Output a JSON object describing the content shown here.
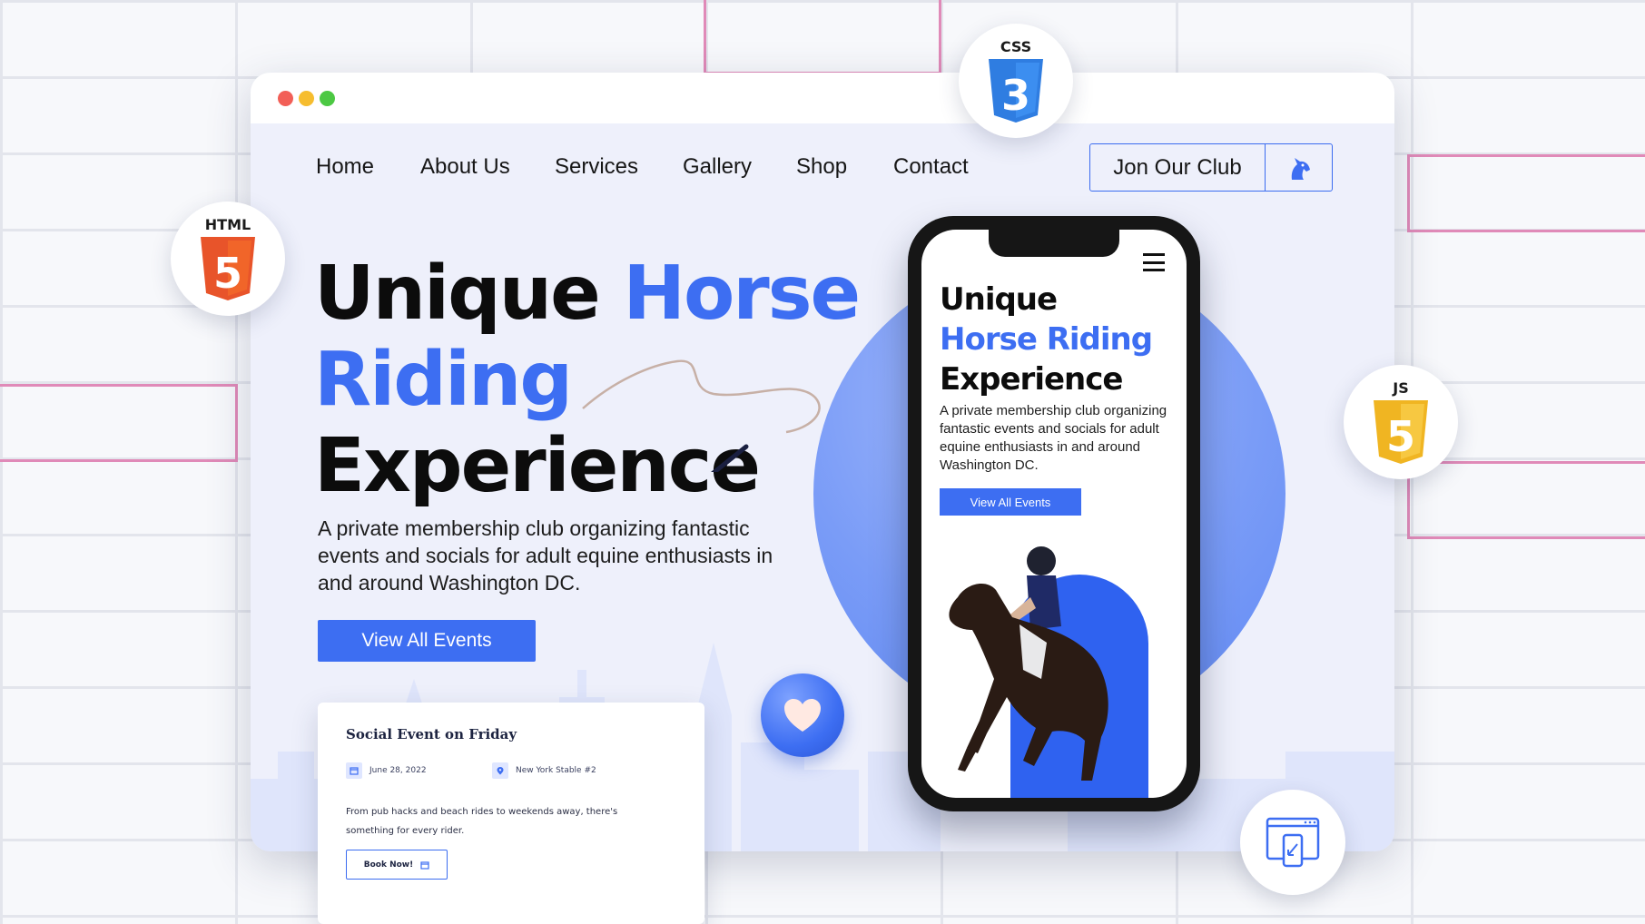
{
  "nav": {
    "items": [
      "Home",
      "About Us",
      "Services",
      "Gallery",
      "Shop",
      "Contact"
    ],
    "cta_label": "Jon Our Club"
  },
  "hero": {
    "title_line1_dark": "Unique",
    "title_line1_blue": "Horse",
    "title_line2_blue": "Riding",
    "title_line3_dark": "Experience",
    "description": "A private membership club organizing fantastic events and socials for adult equine enthusiasts in and around Washington DC.",
    "button_label": "View All Events"
  },
  "event_card": {
    "title": "Social Event on Friday",
    "date": "June 28, 2022",
    "location": "New York Stable #2",
    "description": "From pub hacks and beach rides to weekends away, there's something for every rider.",
    "button_label": "Book Now!"
  },
  "phone": {
    "title_line1": "Unique",
    "title_line2": "Horse Riding",
    "title_line3": "Experience",
    "description": "A private membership club organizing fantastic events and socials for adult equine enthusiasts in and around Washington DC.",
    "button_label": "View All Events"
  },
  "badges": {
    "html_label": "HTML",
    "html_number": "5",
    "css_label": "CSS",
    "css_number": "3",
    "js_label": "JS",
    "js_number": "5"
  },
  "colors": {
    "accent": "#3d6ef2",
    "html_orange": "#e8542a",
    "css_blue": "#2f7de1",
    "js_yellow": "#f0b522",
    "window_dot_red": "#f25f57",
    "window_dot_yellow": "#f6bd2f",
    "window_dot_green": "#4cc843",
    "grid_pink": "#e08ab8"
  },
  "icons": {
    "club": "horse-head-icon",
    "event_date": "calendar-icon",
    "event_location": "location-pin-icon",
    "book": "calendar-icon",
    "ball": "heart-icon",
    "responsive": "responsive-devices-icon",
    "phone_menu": "hamburger-menu-icon"
  }
}
